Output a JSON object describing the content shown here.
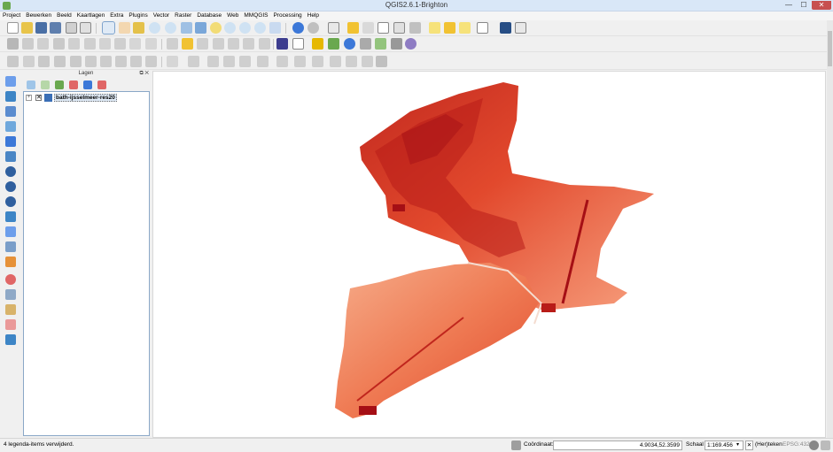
{
  "window": {
    "title": "QGIS2.6.1-Brighton",
    "minimize": "—",
    "maximize": "☐",
    "close": "✕"
  },
  "menu": [
    "Project",
    "Bewerken",
    "Beeld",
    "Kaartlagen",
    "Extra",
    "Plugins",
    "Vector",
    "Raster",
    "Database",
    "Web",
    "MMQGIS",
    "Processing",
    "Help"
  ],
  "layers_panel": {
    "title": "Lagen",
    "float_btn": "⧉",
    "close_btn": "✕",
    "expander": "+",
    "checkbox": "✕",
    "layers": [
      {
        "name": "bath-ijsselmeer-res20",
        "visible": true
      }
    ]
  },
  "statusbar": {
    "message": "4 legenda-items verwijderd.",
    "coord_label": "Coördinaat:",
    "coord_value": "4.9034,52.3599",
    "scale_label": "Schaal",
    "scale_value": "1:169.456",
    "render_check": "✕",
    "render_label": "(Her)teken",
    "crs": "EPSG:4326"
  },
  "colors": {
    "accent": "#3b6fb6",
    "map_dark": "#a50f15",
    "map_mid": "#e2492d",
    "map_light": "#fcbba1"
  }
}
